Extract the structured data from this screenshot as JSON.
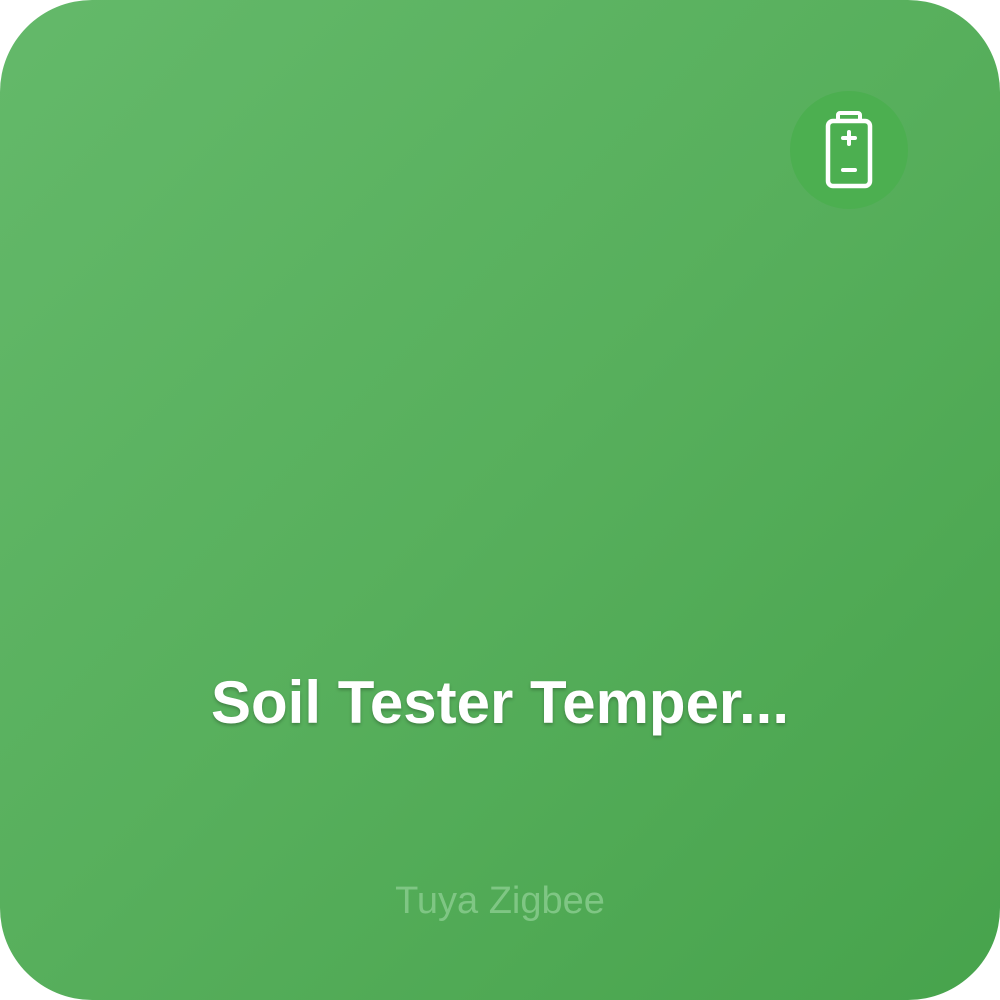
{
  "tile": {
    "name": "Soil Tester Temper...",
    "subtitle": "Tuya Zigbee",
    "status_icon": "battery-icon"
  },
  "colors": {
    "background_start": "#64b96a",
    "background_end": "#47a34c",
    "badge": "#4caf50",
    "name_text": "#ffffff",
    "subtitle_text": "#7fc684"
  }
}
